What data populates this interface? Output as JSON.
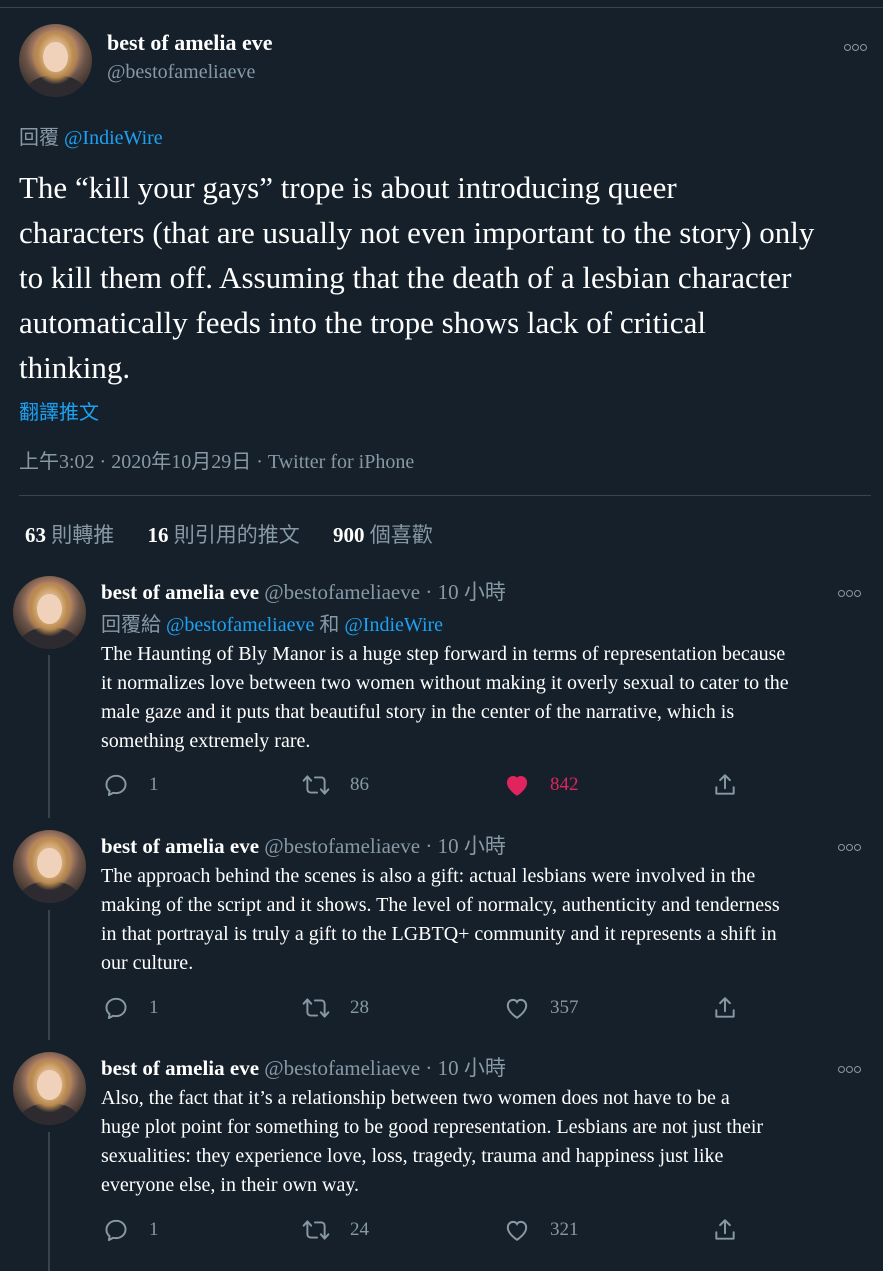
{
  "main_tweet": {
    "name": "best of amelia eve",
    "handle": "@bestofameliaeve",
    "reply_prefix": "回覆",
    "reply_to": "@IndieWire",
    "text": "The “kill your gays” trope is about introducing queer characters (that are usually not even important to the story) only to kill them off. Assuming that the death of a lesbian character automatically feeds into the trope shows lack of critical thinking.",
    "text_lines": [
      "The “kill your gays” trope is about introducing queer",
      "characters (that are usually not even important to the story) only",
      "to kill them off. Assuming that the death of a lesbian character",
      "automatically feeds into the trope shows lack of critical",
      "thinking."
    ],
    "translate": "翻譯推文",
    "meta": "上午3:02 · 2020年10月29日 · Twitter for iPhone",
    "stats": {
      "retweets_num": "63",
      "retweets_label": "則轉推",
      "quotes_num": "16",
      "quotes_label": "則引用的推文",
      "likes_num": "900",
      "likes_label": "個喜歡"
    }
  },
  "replies": [
    {
      "name": "best of amelia eve",
      "handle": "@bestofameliaeve",
      "time": "· 10 小時",
      "reply_line": {
        "prefix": "回覆給",
        "user1": "@bestofameliaeve",
        "joiner": "和",
        "user2": "@IndieWire"
      },
      "text_lines": [
        "The Haunting of Bly Manor is a huge step forward in terms of representation because",
        "it normalizes love between two women without making it overly sexual to cater to the",
        "male gaze and it puts that beautiful story in the center of the narrative, which is",
        "something extremely rare."
      ],
      "replies": "1",
      "retweets": "86",
      "likes": "842",
      "liked": true
    },
    {
      "name": "best of amelia eve",
      "handle": "@bestofameliaeve",
      "time": "· 10 小時",
      "text_lines": [
        "The approach behind the scenes is also a gift: actual lesbians were involved in the",
        "making of the script and it shows. The level of normalcy, authenticity and tenderness",
        "in that portrayal is truly a gift to the LGBTQ+ community and it represents a shift in",
        "our culture."
      ],
      "replies": "1",
      "retweets": "28",
      "likes": "357",
      "liked": false
    },
    {
      "name": "best of amelia eve",
      "handle": "@bestofameliaeve",
      "time": "· 10 小時",
      "text_lines": [
        "Also, the fact that it’s a relationship between two women does not have to be a",
        "huge plot point for something to be good representation. Lesbians are not just their",
        "sexualities: they experience love, loss, tragedy, trauma and happiness just like",
        "everyone else, in their own way."
      ],
      "replies": "1",
      "retweets": "24",
      "likes": "321",
      "liked": false
    }
  ],
  "colors": {
    "background": "#15202b",
    "text_primary": "#ffffff",
    "text_secondary": "#8899a6",
    "link": "#1da1f2",
    "like_active": "#e0245e",
    "divider": "#38444d"
  },
  "icons": [
    "more-icon",
    "reply-icon",
    "retweet-icon",
    "like-icon",
    "share-icon"
  ]
}
